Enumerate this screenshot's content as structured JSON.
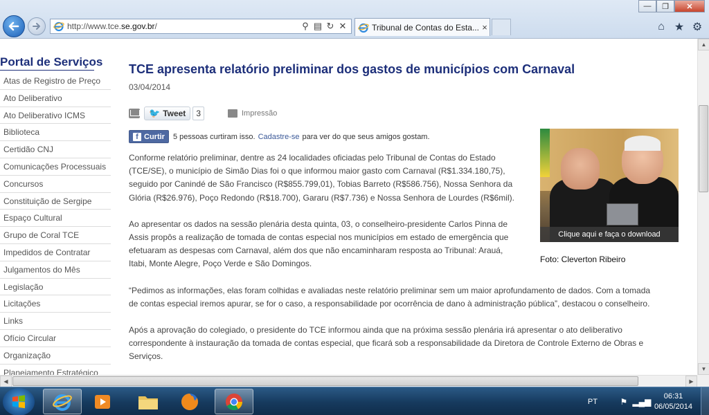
{
  "browser": {
    "url_prefix": "http://www.tce.",
    "url_domain": "se.gov.br",
    "url_suffix": "/",
    "tab_title": "Tribunal de Contas do Esta...",
    "tab_close": "×",
    "window_controls": {
      "minimize": "—",
      "restore": "❐",
      "close": "✕"
    }
  },
  "sidebar": {
    "title_part1": "Portal",
    "title_part2": " de Serviços",
    "items": [
      "Atas de Registro de Preço",
      "Ato Deliberativo",
      "Ato Deliberativo ICMS",
      "Biblioteca",
      "Certidão CNJ",
      "Comunicações Processuais",
      "Concursos",
      "Constituição de Sergipe",
      "Espaço Cultural",
      "Grupo de Coral TCE",
      "Impedidos de Contratar",
      "Julgamentos do Mês",
      "Legislação",
      "Licitações",
      "Links",
      "Ofício Circular",
      "Organização",
      "Planejamento Estratégico"
    ]
  },
  "article": {
    "headline": "TCE apresenta relatório preliminar dos gastos de municípios com Carnaval",
    "date": "03/04/2014",
    "tweet_label": "Tweet",
    "tweet_count": "3",
    "print_label": "Impressão",
    "fb_label": "Curtir",
    "fb_text": "5 pessoas curtiram isso.",
    "fb_link": "Cadastre-se",
    "fb_tail": "para ver do que seus amigos gostam.",
    "paragraphs": [
      "Conforme relatório preliminar, dentre as 24 localidades oficiadas pelo Tribunal de Contas do Estado (TCE/SE), o município de Simão Dias foi o que informou maior gasto com Carnaval (R$1.334.180,75), seguido por Canindé de São Francisco (R$855.799,01), Tobias Barreto (R$586.756), Nossa Senhora da Glória (R$26.976), Poço Redondo (R$18.700), Gararu (R$7.736) e Nossa Senhora de Lourdes (R$6mil).",
      "Ao apresentar os dados na sessão plenária desta quinta, 03, o conselheiro-presidente Carlos Pinna de Assis propôs a realização de tomada de contas especial nos municípios em estado de emergência que efetuaram as despesas com Carnaval, além dos que não encaminharam resposta ao Tribunal: Arauá, Itabi, Monte Alegre, Poço Verde e São Domingos.",
      "“Pedimos as informações, elas foram colhidas e avaliadas neste relatório preliminar sem um maior aprofundamento de dados. Com a tomada de contas especial iremos apurar, se for o caso, a responsabilidade por ocorrência de dano à administração pública”, destacou o conselheiro.",
      "Após a aprovação do colegiado, o presidente do TCE informou ainda que na próxima sessão plenária irá apresentar o ato deliberativo correspondente à instauração da tomada de contas especial, que ficará sob a responsabilidade da Diretora de Controle Externo de Obras e Serviços."
    ],
    "photo_caption": "Clique aqui e faça o download",
    "photo_credit": "Foto: Cleverton Ribeiro"
  },
  "taskbar": {
    "language": "PT",
    "time": "06:31",
    "date": "06/05/2014"
  }
}
